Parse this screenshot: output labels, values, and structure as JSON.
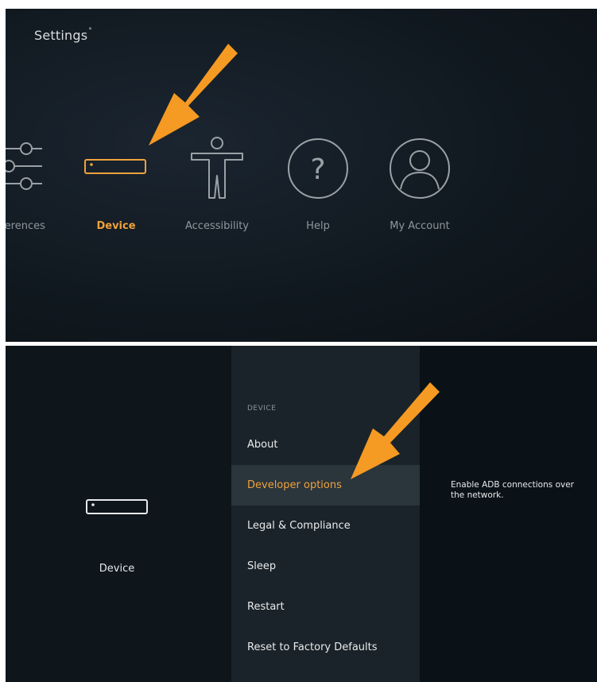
{
  "settings": {
    "title": "Settings",
    "categories": [
      {
        "label": "ferences",
        "icon": "sliders-icon",
        "active": false
      },
      {
        "label": "Device",
        "icon": "device-icon",
        "active": true
      },
      {
        "label": "Accessibility",
        "icon": "accessibility-icon",
        "active": false
      },
      {
        "label": "Help",
        "icon": "help-icon",
        "active": false
      },
      {
        "label": "My Account",
        "icon": "account-icon",
        "active": false
      }
    ]
  },
  "device_screen": {
    "left_label": "Device",
    "menu_header": "DEVICE",
    "menu_items": [
      {
        "label": "About",
        "selected": false
      },
      {
        "label": "Developer options",
        "selected": true
      },
      {
        "label": "Legal & Compliance",
        "selected": false
      },
      {
        "label": "Sleep",
        "selected": false
      },
      {
        "label": "Restart",
        "selected": false
      },
      {
        "label": "Reset to Factory Defaults",
        "selected": false
      }
    ],
    "description": "Enable ADB connections over the network."
  },
  "colors": {
    "accent": "#f0a23b",
    "arrow": "#f59a23",
    "background": "#111920"
  }
}
